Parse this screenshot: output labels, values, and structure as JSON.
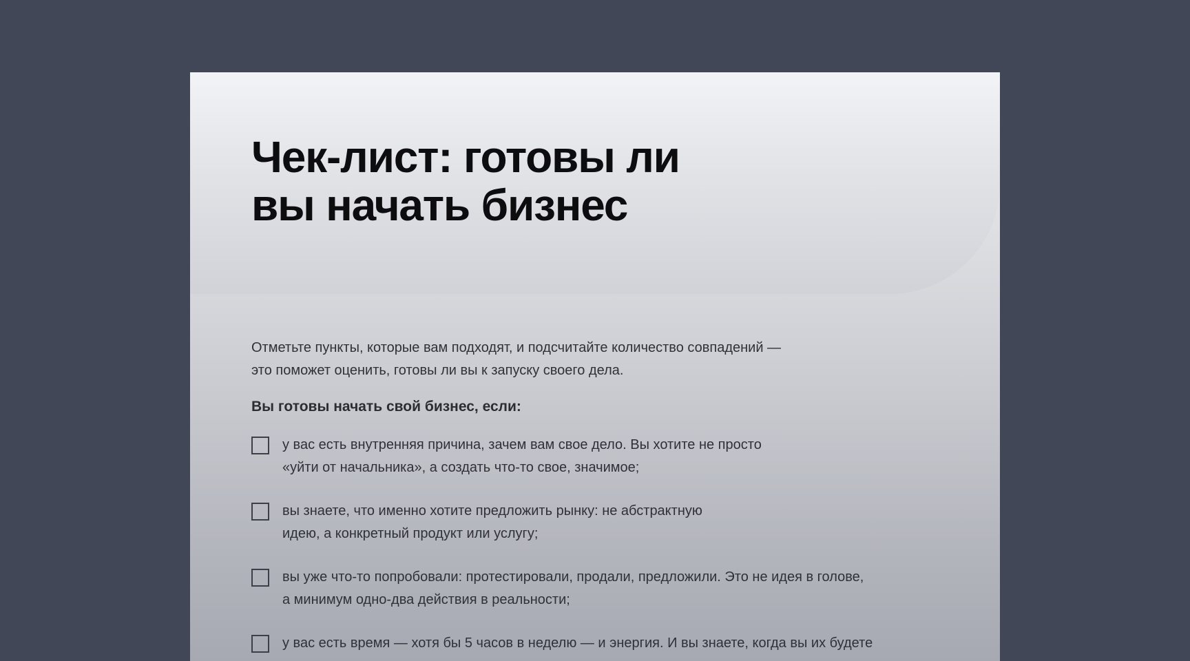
{
  "document": {
    "title_lines": [
      "Чек-лист: готовы ли",
      "вы начать бизнес"
    ],
    "intro_lines": [
      "Отметьте пункты, которые вам подходят, и подсчитайте количество совпадений —",
      "это поможет оценить, готовы ли вы к запуску своего дела."
    ],
    "lead": "Вы готовы начать свой бизнес, если:",
    "items": [
      {
        "checked": false,
        "lines": [
          "у вас есть внутренняя причина, зачем вам свое дело. Вы хотите не просто",
          "«уйти от начальника», а создать что-то свое, значимое;"
        ]
      },
      {
        "checked": false,
        "lines": [
          "вы знаете, что именно хотите предложить рынку: не абстрактную",
          "идею, а конкретный продукт или услугу;"
        ]
      },
      {
        "checked": false,
        "lines": [
          "вы уже что-то попробовали: протестировали, продали, предложили. Это не идея в голове,",
          "а минимум одно-два действия в реальности;"
        ]
      },
      {
        "checked": false,
        "lines": [
          "у вас есть время — хотя бы 5 часов в неделю — и энергия. И вы знаете, когда вы их будете"
        ]
      }
    ]
  }
}
